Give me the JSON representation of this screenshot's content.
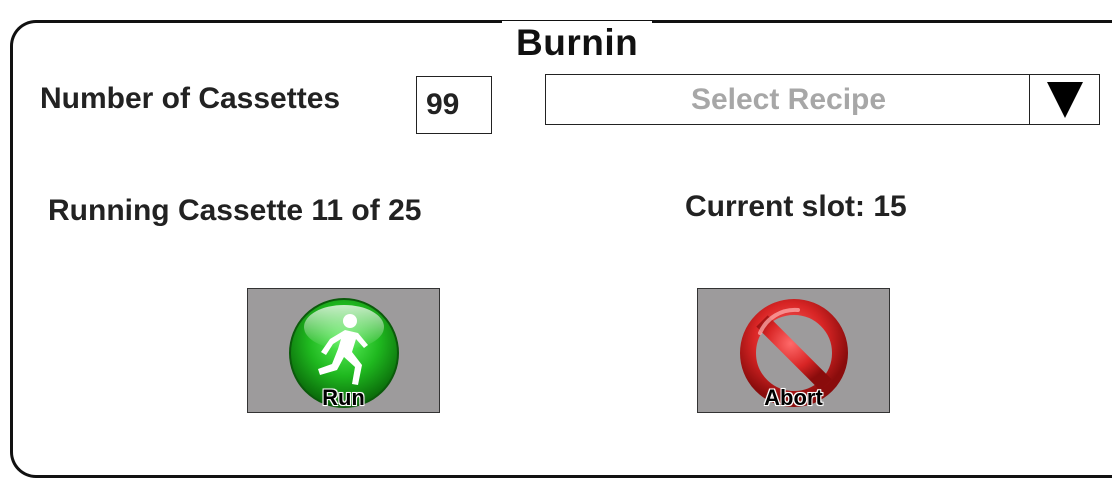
{
  "group": {
    "title": "Burnin"
  },
  "cassettes": {
    "label": "Number of Cassettes",
    "value": "99"
  },
  "recipe": {
    "placeholder": "Select Recipe",
    "arrow_icon": "triangle-down-icon"
  },
  "status": {
    "running": "Running Cassette 11 of 25",
    "slot": "Current slot: 15"
  },
  "buttons": {
    "run": {
      "label": "Run",
      "icon": "runner-icon"
    },
    "abort": {
      "label": "Abort",
      "icon": "prohibited-icon"
    }
  },
  "colors": {
    "button_bg": "#9d9b9c",
    "run_green": "#1fc21f",
    "abort_red": "#d82525",
    "placeholder_gray": "#a7a7a7"
  }
}
